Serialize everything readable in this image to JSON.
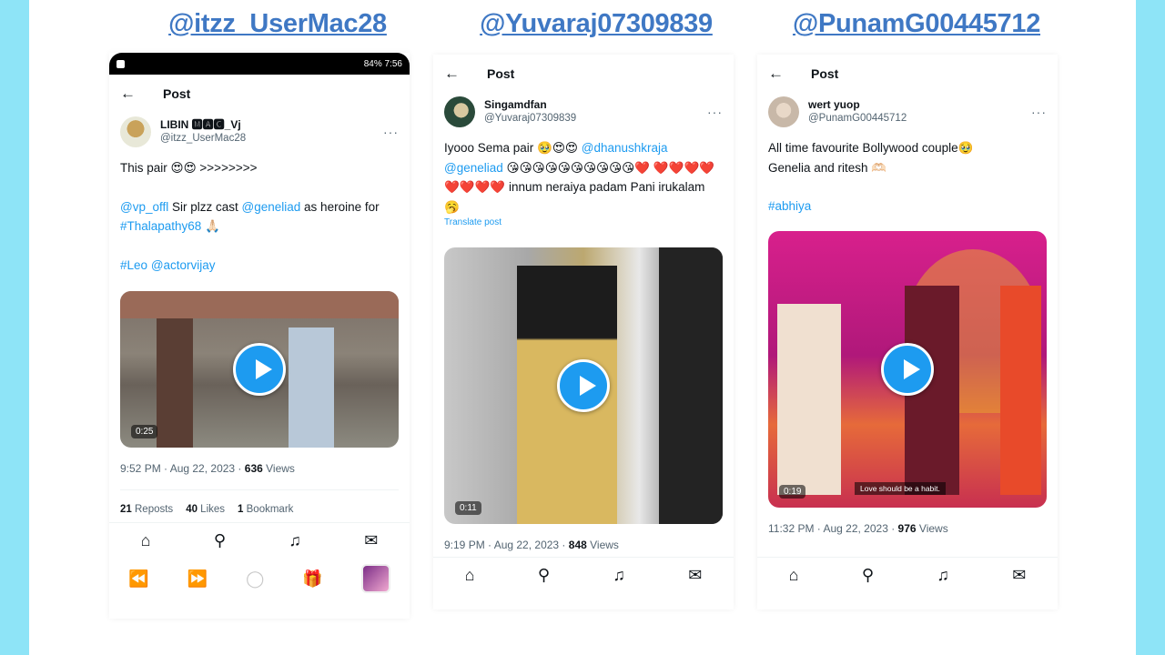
{
  "colors": {
    "page_bg": "#8ee4f7",
    "handle": "#3f78c4",
    "link": "#1d9bf0"
  },
  "icons": {
    "back": "←",
    "more": "···",
    "home": "⌂",
    "search": "⚲",
    "bell": "♫",
    "mail": "✉",
    "rewind": "⏪",
    "forward": "⏩",
    "spinner": "◯",
    "gift": "🎁"
  },
  "panels": [
    {
      "handle": "@itzz_UserMac28",
      "status": {
        "left": "",
        "right": "84% 7:56"
      },
      "header_title": "Post",
      "display_name": "LIBIN 🅼🅰🅲_Vj",
      "username": "@itzz_UserMac28",
      "line1": "This pair 😍😍 >>>>>>>>",
      "mention1": "@vp_offl",
      "text2": " Sir plzz cast ",
      "mention2": "@geneliad",
      "text3": " as heroine for ",
      "hashtag1": "#Thalapathy68",
      "text4": " 🙏🏻",
      "hashtag2": "#Leo",
      "mention3": "@actorvijay",
      "duration": "0:25",
      "meta_time": "9:52 PM · Aug 22, 2023 · ",
      "views": "636",
      "views_label": " Views",
      "reposts": "21",
      "reposts_label": " Reposts",
      "likes": "40",
      "likes_label": " Likes",
      "bookmarks": "1",
      "bookmarks_label": " Bookmark"
    },
    {
      "handle": "@Yuvaraj07309839",
      "header_title": "Post",
      "display_name": "Singamdfan",
      "username": "@Yuvaraj07309839",
      "text1": "Iyooo Sema pair 🥹😍😍 ",
      "mention1": "@dhanushkraja",
      "mention2": "@geneliad",
      "text2": " 😘😘😘😘😘😘😘😘😘😘❤️",
      "hearts": "❤️❤️❤️❤️❤️❤️❤️❤️",
      "text3": " innum neraiya padam Pani irukalam 🥱",
      "translate": "Translate post",
      "duration": "0:11",
      "meta_time": "9:19 PM · Aug 22, 2023 · ",
      "views": "848",
      "views_label": " Views"
    },
    {
      "handle": "@PunamG00445712",
      "header_title": "Post",
      "display_name": "wert yuop",
      "username": "@PunamG00445712",
      "text1": "All time favourite Bollywood couple🥹",
      "text2": "Genelia and ritesh 🫶🏻",
      "hashtag1": "#abhiya",
      "duration": "0:19",
      "caption": "Love should be a habit.",
      "meta_time": "11:32 PM · Aug 22, 2023 · ",
      "views": "976",
      "views_label": " Views"
    }
  ]
}
